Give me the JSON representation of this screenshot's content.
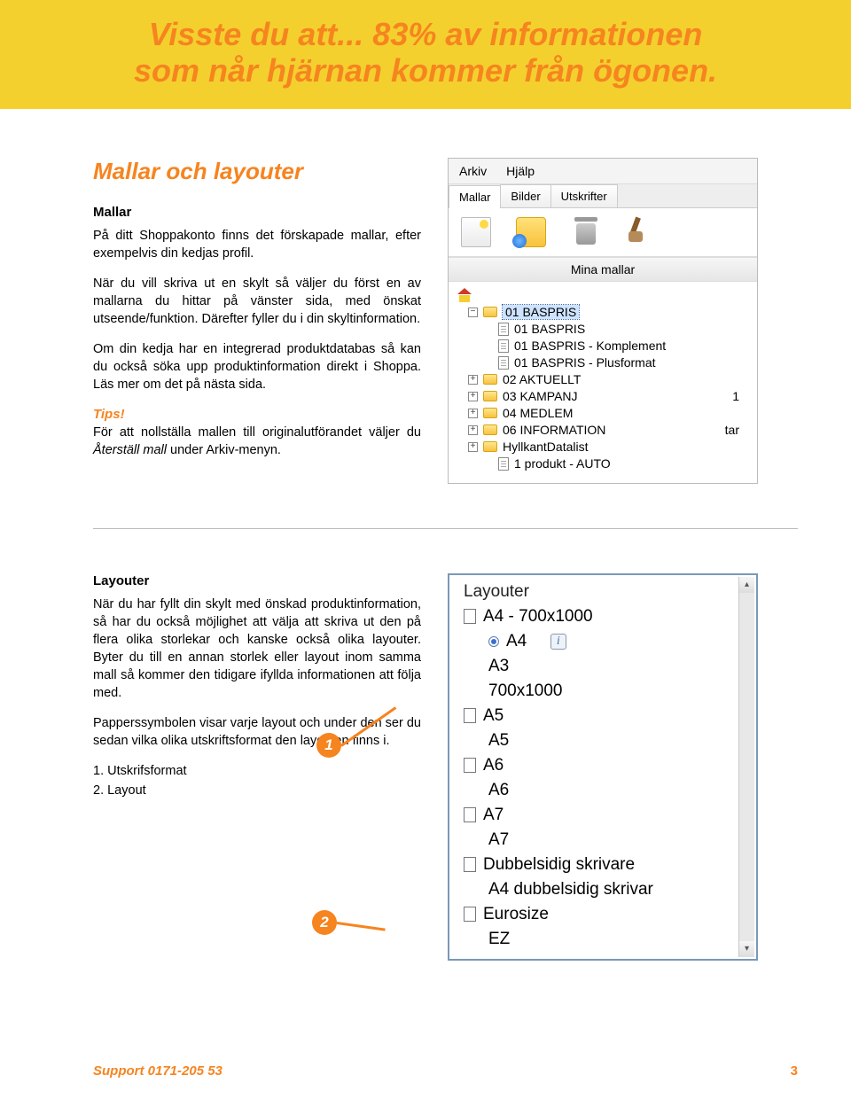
{
  "banner": {
    "line1": "Visste du att... 83% av informationen",
    "line2": "som når hjärnan kommer från ögonen."
  },
  "section1": {
    "title": "Mallar och layouter",
    "heading": "Mallar",
    "p1": "På ditt Shoppakonto finns det förskapade mallar, efter exempelvis din kedjas profil.",
    "p2": "När du vill skriva ut en skylt så väljer du först en av mallarna du hittar på vänster sida, med önskat utseende/funktion. Därefter fyller du i din skyltinformation.",
    "p3": "Om din kedja har en integrerad produktdatabas så kan du också söka upp produktinformation direkt i Shoppa. Läs mer om det på nästa sida.",
    "tips_label": "Tips!",
    "tips_text_a": "För att nollställa mallen till originalutförandet väljer du ",
    "tips_text_i": "Återställ mall",
    "tips_text_b": " under Arkiv-menyn."
  },
  "app": {
    "menu": {
      "arkiv": "Arkiv",
      "hjalp": "Hjälp"
    },
    "tabs": {
      "mallar": "Mallar",
      "bilder": "Bilder",
      "utskrifter": "Utskrifter"
    },
    "panel_title": "Mina mallar",
    "tree": {
      "r0": "01 BASPRIS",
      "r1": "01 BASPRIS",
      "r2": "01 BASPRIS - Komplement",
      "r3": "01 BASPRIS - Plusformat",
      "r4": "02 AKTUELLT",
      "r5": "03 KAMPANJ",
      "r6": "04 MEDLEM",
      "r7": "06 INFORMATION",
      "r8": "HyllkantDatalist",
      "r9": "1 produkt - AUTO",
      "side1": "1",
      "side2": "tar"
    }
  },
  "section2": {
    "heading": "Layouter",
    "p1": "När du har fyllt din skylt med önskad produktinformation, så har du också möjlighet att välja att skriva ut den på flera olika storlekar och kanske också olika layouter. Byter du till en annan storlek eller layout inom samma mall så kommer den tidigare ifyllda informationen att följa med.",
    "p2": "Papperssymbolen visar varje layout och under den ser du sedan vilka olika utskriftsformat den layouten finns i.",
    "li1": "1.    Utskrifsformat",
    "li2": "2.    Layout"
  },
  "layouter": {
    "title": "Layouter",
    "r0": "A4 - 700x1000",
    "r1": "A4",
    "r2": "A3",
    "r3": "700x1000",
    "r4": "A5",
    "r5": "A5",
    "r6": "A6",
    "r7": "A6",
    "r8": "A7",
    "r9": "A7",
    "r10": "Dubbelsidig skrivare",
    "r11": "A4 dubbelsidig skrivar",
    "r12": "Eurosize",
    "r13": "EZ"
  },
  "callouts": {
    "b1": "1",
    "b2": "2"
  },
  "footer": {
    "support": "Support 0171-205 53",
    "page": "3"
  }
}
